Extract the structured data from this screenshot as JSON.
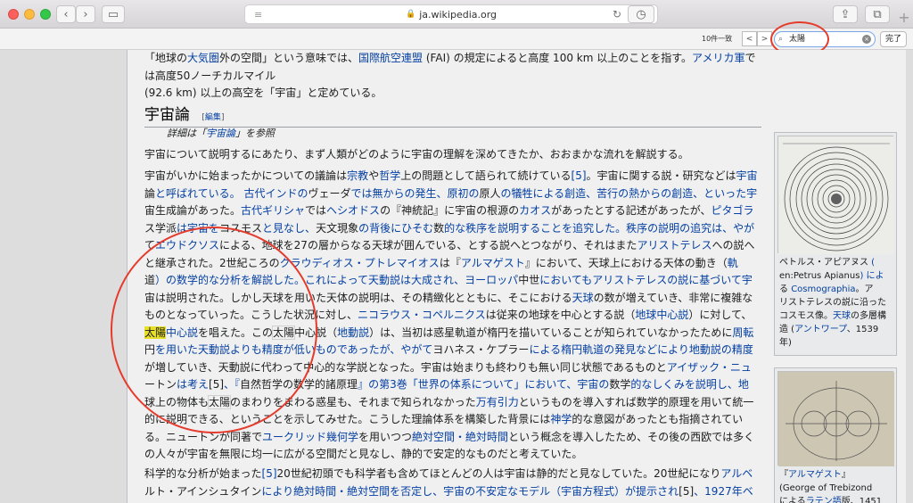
{
  "browser": {
    "url": "ja.wikipedia.org",
    "lock_icon": "🔒",
    "plus": "+"
  },
  "find": {
    "count": "10件一致",
    "query": "太陽",
    "done": "完了",
    "prev": "<",
    "next": ">"
  },
  "article": {
    "intro_line1_a": "「地球の",
    "intro_line1_link1": "大気圏",
    "intro_line1_b": "外の空間」という意味では、",
    "intro_line1_link2": "国際航空連盟",
    "intro_line1_c": " (FAI) の規定によると高度 100 km 以上のことを指す。",
    "intro_line1_link3": "アメリカ軍",
    "intro_line1_d": "では高度50ノーチカルマイル",
    "intro_line2": "(92.6 km) 以上の高空を「宇宙」と定めている。",
    "heading": "宇宙論",
    "edit_label": "[",
    "edit_link": "編集",
    "edit_close": "]",
    "hatnote_a": "詳細は「",
    "hatnote_link": "宇宙論",
    "hatnote_b": "」を参照",
    "p1": "宇宙について説明するにあたり、まず人類がどのように宇宙の理解を深めてきたか、おおまかな流れを解説する。",
    "p2_lines": [
      [
        "宇宙がいかに始まったかについての議論は",
        "宗教",
        "や",
        "哲学",
        "上の問題として語られて続けている",
        "[5]",
        "。宇宙に関する説・研究などは",
        "宇宙"
      ],
      [
        "論",
        "と呼ばれている。 古代インドの",
        "ヴェーダ",
        "では無からの発生、原初の",
        "原人",
        "の犠牲による創造、苦行の熱からの創造、といった宇"
      ],
      [
        "宙生成論があった。",
        "古代ギリシャ",
        "では",
        "ヘシオドス",
        "の『神統記』に宇宙の根源の",
        "カオス",
        "があったとする記述があったが、",
        "ピタゴラ"
      ],
      [
        "ス学派",
        "は宇宙を",
        "コスモス",
        "と見なし、",
        "天文現象",
        "の背後にひそむ",
        "数",
        "的な秩序を説明することを追究した。秩序の説明の追究は、やが"
      ],
      [
        "て",
        "エウドクソス",
        "による、地球を27の層からなる天球が囲んでいる、とする説へとつながり、それはまた",
        "アリストテレス",
        "への説へ"
      ],
      [
        "と継承された。2世紀ころの",
        "クラウディオス・プトレマイオス",
        "は『",
        "アルマゲスト",
        "』において、天球上における天体の動き（",
        "軌"
      ],
      [
        "道",
        "）の数学的な分析を解説した。これによって天動説は大成され、ヨーロッパ",
        "中世",
        "においてもアリストテレスの説に基づいて宇"
      ],
      [
        "宙は説明された。しかし天球を用いた天体の説明は、その精緻化とともに、そこにおける",
        "天球",
        "の数が増えていき、非常に複雑な"
      ],
      [
        "ものとなっていった。こうした状況に対し、",
        "ニコラウス・コペルニクス",
        "は従来の地球を中心とする説（",
        "地球中心説",
        "）に対して、"
      ],
      [
        "太陽",
        "中心説",
        "を唱えた。この",
        "太陽",
        "中心説（",
        "地動説",
        "）は、当初は惑星軌道が楕円を描いていることが知られていなかったために",
        "周転"
      ],
      [
        "円",
        "を用いた天動説よりも精度が低いものであったが、やがて",
        "ヨハネス・ケプラー",
        "による楕円軌道の発見などにより地動説の精度"
      ],
      [
        "が増していき、天動説に代わって中心的な学説となった。宇宙は始まりも終わりも無い同じ状態であるものと",
        "アイザック・ニュ"
      ],
      [
        "ートン",
        "は考え",
        "[5]",
        "、『",
        "自然哲学の数学的諸原理",
        "』の第3巻「世界の体系について」において、宇宙の",
        "数学",
        "的なしくみを説明し、地"
      ],
      [
        "球上の物体も",
        "太陽",
        "のまわりをまわる惑星も、それまで知られなかった",
        "万有引力",
        "というものを導入すれば数学的原理を用いて統一"
      ],
      [
        "的に説明できる、ということを示してみせた。こうした理論体系を構築した背景には",
        "神学",
        "的な意図があったとも指摘されてい"
      ],
      [
        "る。ニュートンが同著で",
        "ユークリッド幾何学",
        "を用いつつ",
        "絶対空間・絶対時間",
        "という概念を導入したため、その後の西欧では多く"
      ],
      [
        "の人々が宇宙を無限に均一に広がる空間だと見なし、静的で安定的なものだと考えていた。"
      ]
    ],
    "p3_lines": [
      [
        "科学的な分析が始まった",
        "[5]",
        "20世紀初頭でも科学者も含めてほとんどの人は宇宙は静的だと見なしていた。20世紀になり",
        "アルベ"
      ],
      [
        "ルト・アインシュタイン",
        "により絶対時間・絶対空間を否定し、宇宙の不安定なモデル（宇宙方程式）が提示され",
        "[5]",
        "、1927年ベ"
      ]
    ]
  },
  "thumb1": {
    "caption": [
      [
        "ペトルス・アピアヌス",
        " ("
      ],
      [
        "en:Petrus Apianus",
        ") によ"
      ],
      [
        "る ",
        "Cosmographia",
        "。ア"
      ],
      [
        "リストテレスの説に沿った"
      ],
      [
        "コスモス像。",
        "天球",
        "の多層構"
      ],
      [
        "造 (",
        "アントワープ",
        "、1539"
      ],
      [
        "年)"
      ]
    ]
  },
  "thumb2": {
    "caption": [
      [
        "『",
        "アルマゲスト",
        "』"
      ],
      [
        "(George of Trebizond"
      ],
      [
        "による",
        "ラテン語",
        "版、1451"
      ]
    ]
  }
}
